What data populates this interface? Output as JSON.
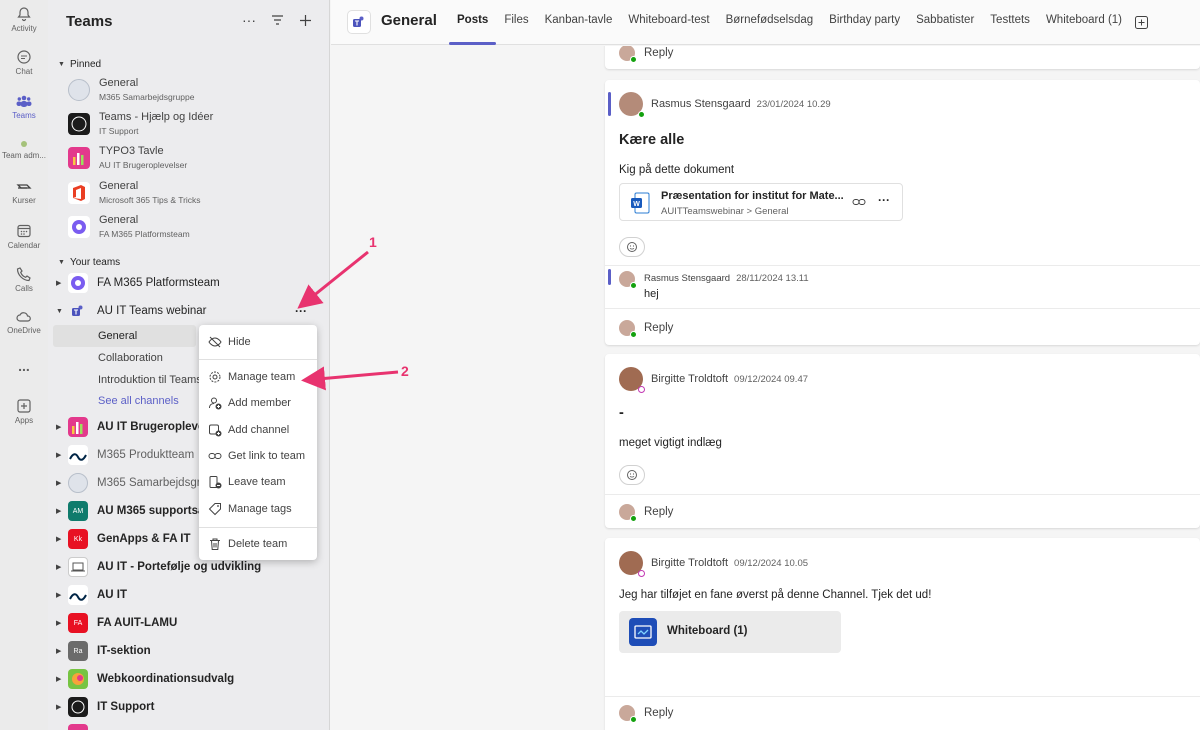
{
  "rail": [
    {
      "label": "Activity",
      "icon": "bell-icon"
    },
    {
      "label": "Chat",
      "icon": "chat-icon"
    },
    {
      "label": "Teams",
      "icon": "teams-icon"
    },
    {
      "label": "Team adm...",
      "icon": "dot-icon"
    },
    {
      "label": "Kurser",
      "icon": "kurser-icon"
    },
    {
      "label": "Calendar",
      "icon": "calendar-icon"
    },
    {
      "label": "Calls",
      "icon": "phone-icon"
    },
    {
      "label": "OneDrive",
      "icon": "cloud-icon"
    },
    {
      "label": "...",
      "icon": "more-icon"
    },
    {
      "label": "Apps",
      "icon": "apps-icon"
    }
  ],
  "sidebar": {
    "title": "Teams",
    "pinned_label": "Pinned",
    "pinned": [
      {
        "name": "General",
        "team": "M365 Samarbejdsgruppe",
        "color": "#dfe3ea"
      },
      {
        "name": "Teams - Hjælp og Idéer",
        "team": "IT Support",
        "color": "#1b1b1b"
      },
      {
        "name": "TYPO3 Tavle",
        "team": "AU IT Brugeroplevelser",
        "color": "#e3398c"
      },
      {
        "name": "General",
        "team": "Microsoft 365 Tips & Tricks",
        "color": "#ea3e23"
      },
      {
        "name": "General",
        "team": "FA M365 Platformsteam",
        "color": "#7a5cf0"
      }
    ],
    "your_teams_label": "Your teams",
    "teams": [
      {
        "name": "FA M365 Platformsteam",
        "bold": false,
        "initials": "",
        "color": "#7a5cf0"
      },
      {
        "name": "AU IT Teams webinar",
        "bold": false,
        "initials": "",
        "color": "#ececee"
      },
      {
        "name": "AU IT Brugeroplevelser",
        "bold": true,
        "initials": "",
        "color": "#e3398c"
      },
      {
        "name": "M365 Produktteam",
        "bold": false,
        "initials": "",
        "color": "#ffffff"
      },
      {
        "name": "M365 Samarbejdsgruppe",
        "bold": false,
        "initials": "",
        "color": "#dfe3ea"
      },
      {
        "name": "AU M365 supportsamarbejde",
        "bold": true,
        "initials": "AM",
        "color": "#0f7b6c"
      },
      {
        "name": "GenApps & FA IT",
        "bold": true,
        "initials": "Kk",
        "color": "#e81123"
      },
      {
        "name": "AU IT - Portefølje og udvikling",
        "bold": true,
        "initials": "",
        "color": "#ffffff"
      },
      {
        "name": "AU IT",
        "bold": true,
        "initials": "",
        "color": "#ffffff"
      },
      {
        "name": "FA AUIT-LAMU",
        "bold": true,
        "initials": "FA",
        "color": "#e81123"
      },
      {
        "name": "IT-sektion",
        "bold": true,
        "initials": "Ra",
        "color": "#6b6b6b"
      },
      {
        "name": "Webkoordinationsudvalg",
        "bold": true,
        "initials": "",
        "color": "#76c442"
      },
      {
        "name": "IT Support",
        "bold": true,
        "initials": "",
        "color": "#1b1b1b"
      }
    ],
    "channels": [
      "General",
      "Collaboration",
      "Introduktion til Teams",
      "See all channels"
    ]
  },
  "context_menu": {
    "items": [
      {
        "label": "Hide",
        "icon": "hide-icon"
      },
      {
        "label": "Manage team",
        "icon": "gear-icon"
      },
      {
        "label": "Add member",
        "icon": "add-member-icon"
      },
      {
        "label": "Add channel",
        "icon": "add-channel-icon"
      },
      {
        "label": "Get link to team",
        "icon": "link-icon"
      },
      {
        "label": "Leave team",
        "icon": "leave-icon"
      },
      {
        "label": "Manage tags",
        "icon": "tag-icon"
      },
      {
        "label": "Delete team",
        "icon": "trash-icon"
      }
    ]
  },
  "topbar": {
    "channel_title": "General",
    "tabs": [
      "Posts",
      "Files",
      "Kanban-tavle",
      "Whiteboard-test",
      "Børnefødselsdag",
      "Birthday party",
      "Sabbatister",
      "Testtets",
      "Whiteboard (1)"
    ]
  },
  "feed": {
    "reply_label": "Reply",
    "post1": {
      "author": "Rasmus Stensgaard",
      "time": "23/01/2024 10.29",
      "subject": "Kære alle",
      "body": "Kig på dette dokument",
      "file_name": "Præsentation for institut for Mate...",
      "file_path": "AUITTeamswebinar > General",
      "reply_author": "Rasmus Stensgaard",
      "reply_time": "28/11/2024 13.11",
      "reply_body": "hej"
    },
    "post2": {
      "author": "Birgitte Troldtoft",
      "time": "09/12/2024 09.47",
      "subject": "-",
      "body": "meget vigtigt indlæg"
    },
    "post3": {
      "author": "Birgitte Troldtoft",
      "time": "09/12/2024 10.05",
      "body": "Jeg har tilføjet en fane øverst på denne Channel. Tjek det ud!",
      "card_label": "Whiteboard (1)"
    }
  },
  "annotations": {
    "arrow1": "1",
    "arrow2": "2",
    "color": "#e8336f"
  },
  "colors": {
    "brand": "#5b5fc7",
    "annotation": "#e8336f"
  }
}
